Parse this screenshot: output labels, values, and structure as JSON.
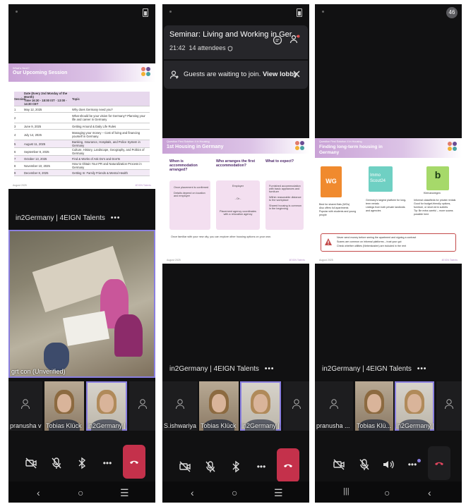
{
  "colors": {
    "accent": "#8a7fe0",
    "hangup": "#c4314b",
    "slide_purple": "#b58cc8",
    "panel_bg": "#111112"
  },
  "panel1": {
    "slide": {
      "kicker": "What's Next?",
      "title": "Our Upcoming Session",
      "headers": [
        "Session",
        "Date (Every 2nd Monday of the Month)\nTime 16:30 - 18:00 IST · 13:00 - 14:30 CET",
        "Topic"
      ],
      "rows": [
        [
          "1",
          "May 12, 2025",
          "Why does Germany need you?"
        ],
        [
          "2",
          "",
          "What should be your vision for Germany? Planning your life and career in Germany"
        ],
        [
          "3",
          "June 9, 2025",
          "Getting Around & Daily Life Rules"
        ],
        [
          "4",
          "July 14, 2025",
          "Managing your money – Cost of living and financing yourself in Germany"
        ],
        [
          "5",
          "August 11, 2025",
          "Banking, Insurance, Hospitals, and Police System in Germany"
        ],
        [
          "6",
          "September 8, 2025",
          "Culture, History, Landscape, Geography, and Politics of Germany"
        ],
        [
          "7",
          "October 13, 2025",
          "Find & Works of Ask Do's and Don'ts"
        ],
        [
          "8",
          "November 10, 2025",
          "How to Obtain Your PR and Naturalization Process in Germany"
        ],
        [
          "9",
          "December 8, 2025",
          "Getting In: Family Friends & Mental Health"
        ]
      ],
      "footer_left": "August 2025",
      "footer_right": "4EIGN Talents"
    },
    "talents": "in2Germany | 4EIGN Talents",
    "more": "•••",
    "video_label": "grt con (Unverified)",
    "tiles": [
      "pranusha v (G...",
      "Tobias Klück",
      "in2Germany | 4..."
    ]
  },
  "panel2": {
    "banner": {
      "title": "Seminar: Living and Working in Ger...",
      "time": "21:42",
      "attendees": "14 attendees",
      "lobby_text": "Guests are waiting to join.",
      "lobby_link": "View lobby"
    },
    "slide": {
      "kicker": "Question First Solution 4 in Housing",
      "title": "1st Housing in Germany",
      "col1": "When is accommodation arranged?",
      "col2": "Who arranges the first accommodation?",
      "col3": "What to expect?",
      "c1a": "Once placement is confirmed",
      "c1b": "Details depend on location and employer",
      "c2a": "Employer",
      "c2or": "- Or -",
      "c2b": "Placement agency coordinates with a relocation agency",
      "c3a": "Furnished accommodation with basic appliances and furniture",
      "c3b": "Within reasonable distance to the workplace",
      "c3c": "Shared housing is common in the beginning",
      "bottom": "Once familiar with your new city, you can explore other housing options on your own.",
      "footer_left": "August 2025",
      "footer_right": "4EIGN Talents"
    },
    "talents": "in2Germany | 4EIGN Talents",
    "more": "•••",
    "tiles": [
      "S.ishwariya ...",
      "Tobias Klück",
      "in2Germany | 4..."
    ]
  },
  "panel3": {
    "badge": "46",
    "slide": {
      "kicker": "Question First Solution 4 in Housing",
      "title": "Finding long-term housing in Germany",
      "logo1": "WG",
      "logo2a": "Immo",
      "logo2b": "Scout24",
      "logo3": "Kleinanzeigen",
      "l1": [
        "Best for shared flats (WGs)",
        "Also offers full apartments",
        "Popular with students and young people"
      ],
      "l2": [
        "Germany's largest platform for long-term rentals",
        "Listings from both private landlords and agencies"
      ],
      "l3": [
        "Informal classifieds for private rentals",
        "Good for budget-friendly options, furniture, or short-term sublets",
        "Tip: Be extra careful – more scams possible here"
      ],
      "warn": [
        "Never send money before seeing the apartment and signing a contract",
        "Scams are common on informal platforms – trust your gut",
        "Check whether utilities (Nebenkosten) are included in the rent"
      ],
      "footer_left": "August 2025",
      "footer_right": "4EIGN Talents"
    },
    "talents": "in2Germany | 4EIGN Talents",
    "more": "•••",
    "tiles": [
      "pranusha ...",
      "Tobias Klü...",
      "in2Germany |..."
    ]
  },
  "nav": {
    "back": "‹",
    "home": "○",
    "recents": "☰",
    "recents3": "|||"
  }
}
